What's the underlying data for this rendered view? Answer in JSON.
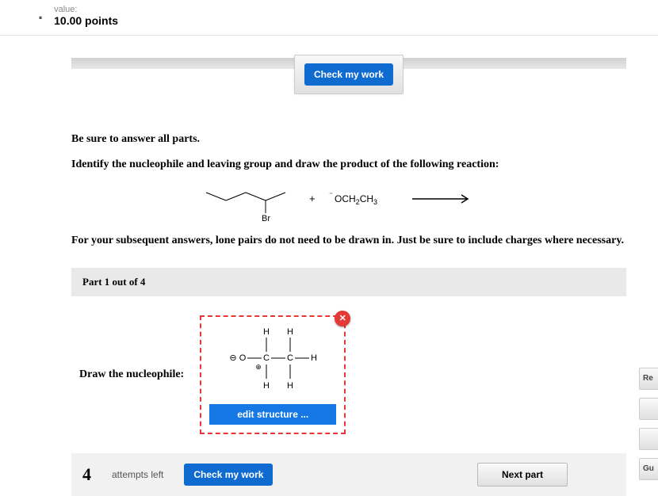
{
  "header": {
    "dot": ".",
    "value_label": "value:",
    "points": "10.00 points"
  },
  "buttons": {
    "check_my_work": "Check my work",
    "edit_structure": "edit structure ...",
    "next_part": "Next part"
  },
  "instructions": {
    "line1": "Be sure to answer all parts.",
    "line2": "Identify the nucleophile and leaving group and draw the product of the following reaction:",
    "line3": "For your subsequent answers, lone pairs do not need to be drawn in. Just be sure to include charges where necessary."
  },
  "reaction": {
    "reagent_label": "Br",
    "plus": "+",
    "nucleophile_prefix": "⁻",
    "nucleophile_text": "OCH",
    "nucleophile_sub1": "2",
    "nucleophile_tail": "CH",
    "nucleophile_sub2": "3"
  },
  "part": {
    "header": "Part 1 out of 4",
    "prompt": "Draw the nucleophile:"
  },
  "structure_atoms": {
    "H": "H",
    "C": "C",
    "O": "O",
    "minus": "⊖",
    "plus": "⊕"
  },
  "footer": {
    "attempts_num": "4",
    "attempts_text": "attempts left"
  },
  "side": {
    "re": "Re",
    "gu": "Gu"
  }
}
